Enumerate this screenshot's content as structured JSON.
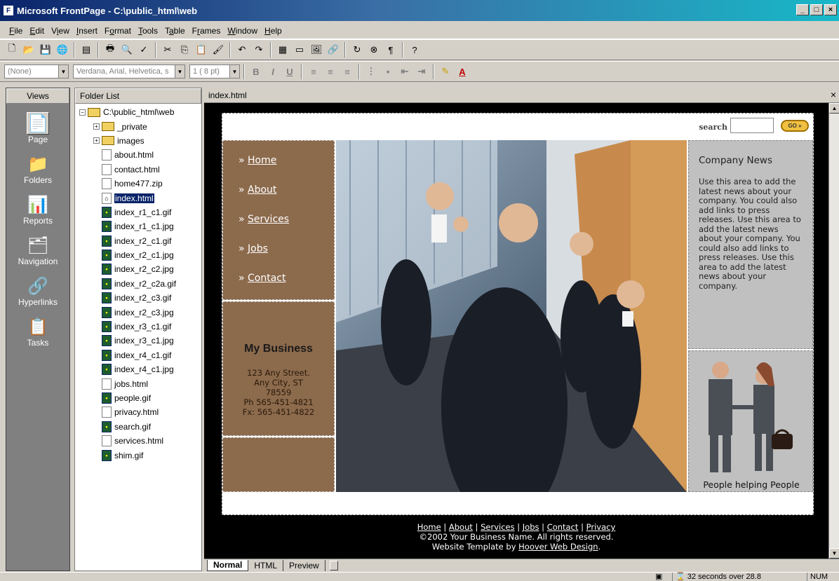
{
  "window": {
    "title": "Microsoft FrontPage - C:\\public_html\\web"
  },
  "menubar": {
    "items": [
      {
        "u": "F",
        "rest": "ile"
      },
      {
        "u": "E",
        "rest": "dit"
      },
      {
        "pre": "V",
        "u": "i",
        "rest": "ew"
      },
      {
        "u": "I",
        "rest": "nsert"
      },
      {
        "pre": "F",
        "u": "o",
        "rest": "rmat"
      },
      {
        "u": "T",
        "rest": "ools"
      },
      {
        "pre": "T",
        "u": "a",
        "rest": "ble"
      },
      {
        "pre": "F",
        "u": "r",
        "rest": "ames"
      },
      {
        "u": "W",
        "rest": "indow"
      },
      {
        "u": "H",
        "rest": "elp"
      }
    ]
  },
  "format_toolbar": {
    "style": "(None)",
    "font": "Verdana, Arial, Helvetica, s",
    "size": "1 ( 8 pt)"
  },
  "views": {
    "header": "Views",
    "items": [
      "Page",
      "Folders",
      "Reports",
      "Navigation",
      "Hyperlinks",
      "Tasks"
    ]
  },
  "folder_list": {
    "header": "Folder List",
    "root": "C:\\public_html\\web",
    "folders": [
      "_private",
      "images"
    ],
    "files": [
      {
        "name": "about.html",
        "type": "html"
      },
      {
        "name": "contact.html",
        "type": "html"
      },
      {
        "name": "home477.zip",
        "type": "zip"
      },
      {
        "name": "index.html",
        "type": "html-home",
        "selected": true
      },
      {
        "name": "index_r1_c1.gif",
        "type": "img"
      },
      {
        "name": "index_r1_c1.jpg",
        "type": "img"
      },
      {
        "name": "index_r2_c1.gif",
        "type": "img"
      },
      {
        "name": "index_r2_c1.jpg",
        "type": "img"
      },
      {
        "name": "index_r2_c2.jpg",
        "type": "img"
      },
      {
        "name": "index_r2_c2a.gif",
        "type": "img"
      },
      {
        "name": "index_r2_c3.gif",
        "type": "img"
      },
      {
        "name": "index_r2_c3.jpg",
        "type": "img"
      },
      {
        "name": "index_r3_c1.gif",
        "type": "img"
      },
      {
        "name": "index_r3_c1.jpg",
        "type": "img"
      },
      {
        "name": "index_r4_c1.gif",
        "type": "img"
      },
      {
        "name": "index_r4_c1.jpg",
        "type": "img"
      },
      {
        "name": "jobs.html",
        "type": "html"
      },
      {
        "name": "people.gif",
        "type": "img"
      },
      {
        "name": "privacy.html",
        "type": "html"
      },
      {
        "name": "search.gif",
        "type": "img"
      },
      {
        "name": "services.html",
        "type": "html"
      },
      {
        "name": "shim.gif",
        "type": "img"
      }
    ]
  },
  "editor": {
    "tab_title": "index.html"
  },
  "page": {
    "search_label": "search",
    "go_label": "GO »",
    "nav": [
      {
        "prefix": "» ",
        "label": "Home"
      },
      {
        "prefix": "» ",
        "label": "About"
      },
      {
        "prefix": "» ",
        "label": "Services"
      },
      {
        "prefix": "» ",
        "label": "Jobs"
      },
      {
        "prefix": "» ",
        "label": "Contact"
      }
    ],
    "business": {
      "name": "My Business",
      "street": "123 Any Street.",
      "city": "Any City, ST",
      "zip": "78559",
      "phone": "Ph 565-451-4821",
      "fax": "Fx: 565-451-4822"
    },
    "news": {
      "title": "Company News",
      "body": "Use this area to add the latest news about your company. You could also add links to press releases. Use this area to add the latest news about your company. You could also add links to press releases. Use this area to add the latest news about your company."
    },
    "people_caption": "People helping People",
    "footer": {
      "links": [
        "Home",
        "About",
        "Services",
        "Jobs",
        "Contact",
        "Privacy"
      ],
      "copyright": "©2002 Your Business Name. All rights reserved.",
      "credit_prefix": "Website Template by ",
      "credit_link": "Hoover Web Design",
      "credit_suffix": "."
    }
  },
  "view_tabs": [
    "Normal",
    "HTML",
    "Preview"
  ],
  "status": {
    "download_time": "32 seconds over 28.8",
    "num": "NUM"
  }
}
